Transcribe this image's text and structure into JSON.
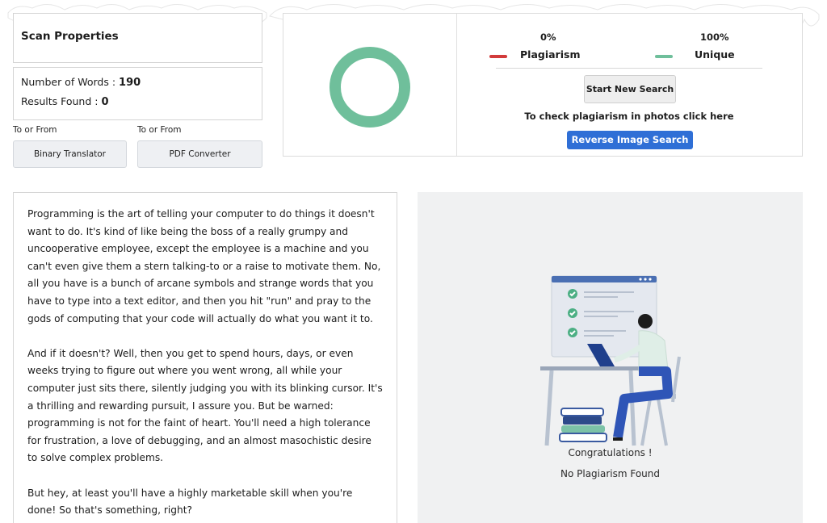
{
  "scan": {
    "title": "Scan Properties",
    "words_label": "Number of Words :",
    "words_value": "190",
    "results_label": "Results Found :",
    "results_value": "0"
  },
  "tools": [
    {
      "label": "To or From",
      "button": "Binary Translator"
    },
    {
      "label": "To or From",
      "button": "PDF Converter"
    }
  ],
  "result": {
    "plagiarism_pct": "0%",
    "unique_pct": "100%",
    "plagiarism_label": "Plagiarism",
    "unique_label": "Unique",
    "plagiarism_color": "#d23b3b",
    "unique_color": "#6fbf9b",
    "start_button": "Start New Search",
    "photo_text": "To check plagiarism in photos click here",
    "reverse_button": "Reverse Image Search"
  },
  "text": {
    "paragraphs": [
      "Programming is the art of telling your computer to do things it doesn't want to do. It's kind of like being the boss of a really grumpy and uncooperative employee, except the employee is a machine and you can't even give them a stern talking-to or a raise to motivate them. No, all you have is a bunch of arcane symbols and strange words that you have to type into a text editor, and then you hit \"run\" and pray to the gods of computing that your code will actually do what you want it to.",
      "And if it doesn't? Well, then you get to spend hours, days, or even weeks trying to figure out where you went wrong, all while your computer just sits there, silently judging you with its blinking cursor. It's a thrilling and rewarding pursuit, I assure you. But be warned: programming is not for the faint of heart. You'll need a high tolerance for frustration, a love of debugging, and an almost masochistic desire to solve complex problems.",
      "But hey, at least you'll have a highly marketable skill when you're done! So that's something, right?"
    ]
  },
  "congrats": {
    "line1": "Congratulations !",
    "line2": "No Plagiarism Found"
  }
}
